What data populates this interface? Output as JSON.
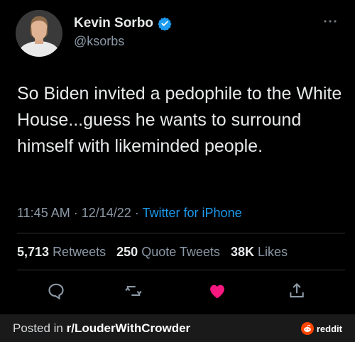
{
  "tweet": {
    "display_name": "Kevin Sorbo",
    "handle": "@ksorbs",
    "more_icon": "more-dots-icon",
    "verified_icon": "verified-badge-icon",
    "verified_color": "#1d9bf0",
    "text": "So Biden invited a pedophile to the White House...guess he wants to surround himself with likeminded people.",
    "time": "11:45 AM",
    "date": "12/14/22",
    "separator": "·",
    "source": "Twitter for iPhone",
    "stats": {
      "retweets_count": "5,713",
      "retweets_label": "Retweets",
      "quotes_count": "250",
      "quotes_label": "Quote Tweets",
      "likes_count": "38K",
      "likes_label": "Likes"
    },
    "actions": [
      "reply-icon",
      "retweet-icon",
      "like-icon",
      "share-icon"
    ],
    "like_color": "#f91880"
  },
  "footer": {
    "posted_in": "Posted in ",
    "subreddit": "r/LouderWithCrowder",
    "brand": "reddit",
    "brand_color": "#ff4500"
  }
}
